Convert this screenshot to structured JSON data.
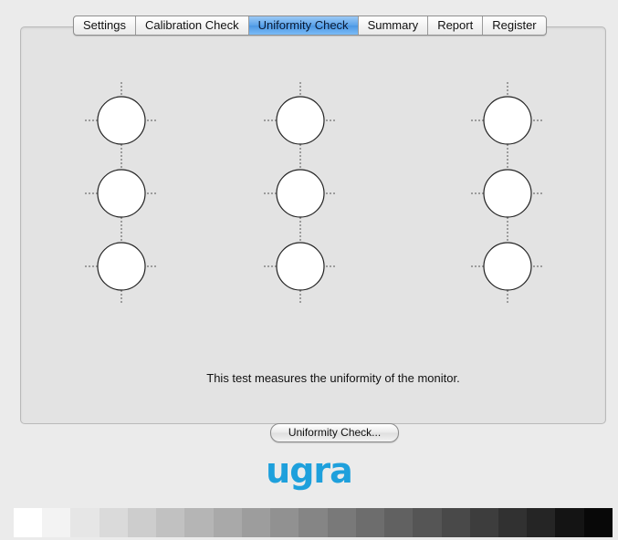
{
  "tabs": [
    {
      "label": "Settings",
      "name": "tab-settings",
      "active": false
    },
    {
      "label": "Calibration Check",
      "name": "tab-calibration-check",
      "active": false
    },
    {
      "label": "Uniformity Check",
      "name": "tab-uniformity-check",
      "active": true
    },
    {
      "label": "Summary",
      "name": "tab-summary",
      "active": false
    },
    {
      "label": "Report",
      "name": "tab-report",
      "active": false
    },
    {
      "label": "Register",
      "name": "tab-register",
      "active": false
    }
  ],
  "main": {
    "description": "This test measures the uniformity of the monitor.",
    "button_label": "Uniformity Check...",
    "target_grid": {
      "rows": 3,
      "columns": 3,
      "icon": "crosshair-circle-icon"
    }
  },
  "logo": {
    "text": "ugra",
    "color": "#1ea0dc"
  },
  "grayscale_strip": [
    "#ffffff",
    "#f3f3f3",
    "#e6e6e6",
    "#dadada",
    "#cdcdcd",
    "#c1c1c1",
    "#b5b5b5",
    "#a9a9a9",
    "#9d9d9d",
    "#919191",
    "#858585",
    "#797979",
    "#6d6d6d",
    "#616161",
    "#555555",
    "#494949",
    "#3d3d3d",
    "#313131",
    "#252525",
    "#141414",
    "#080808"
  ],
  "colors": {
    "tab_active": "#5aa3ea",
    "panel_background": "#e3e3e3",
    "window_background": "#ebebeb"
  }
}
